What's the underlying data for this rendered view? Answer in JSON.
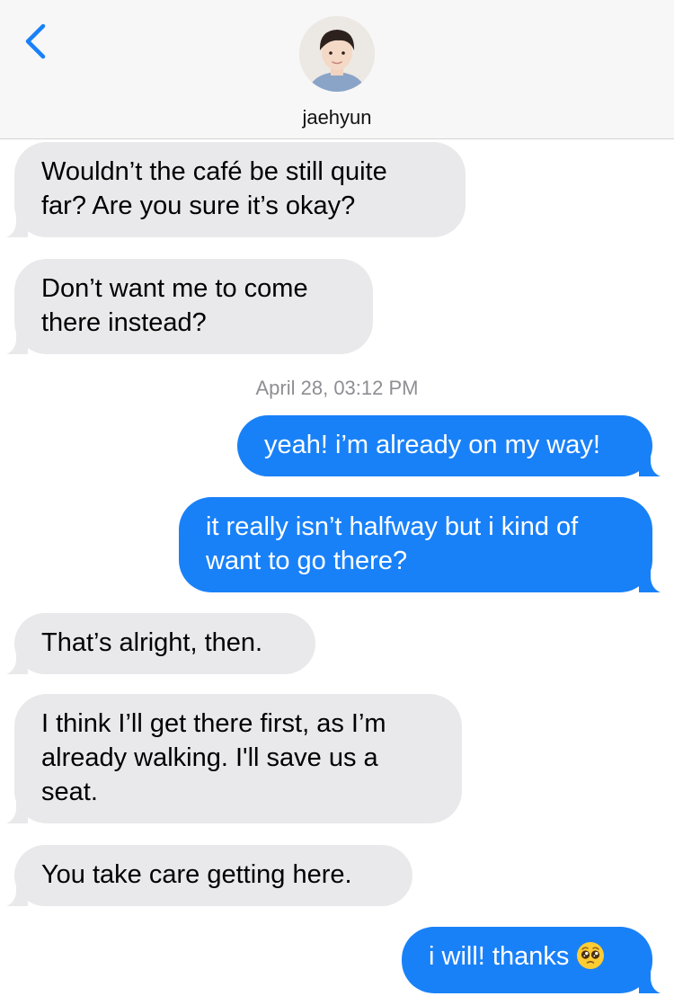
{
  "header": {
    "contact_name": "jaehyun",
    "back_icon": "chevron-left-icon",
    "accent_color": "#1981f8"
  },
  "messages": [
    {
      "direction": "incoming",
      "text": "Wouldn’t the café be still quite far? Are you sure it’s okay?"
    },
    {
      "direction": "incoming",
      "text": "Don’t want me to come there instead?"
    },
    {
      "direction": "outgoing",
      "text": "yeah! i’m already on my way!"
    },
    {
      "direction": "outgoing",
      "text": "it really isn’t halfway but i kind of want to go there?"
    },
    {
      "direction": "incoming",
      "text": "That’s alright, then."
    },
    {
      "direction": "incoming",
      "text": "I think I’ll get there first, as I’m already walking. I'll save us a seat."
    },
    {
      "direction": "incoming",
      "text": "You take care getting here."
    },
    {
      "direction": "outgoing",
      "text": "i will! thanks",
      "emoji": "pleading-face-icon"
    }
  ],
  "timestamp": "April 28, 03:12 PM",
  "colors": {
    "incoming_bubble": "#e9e9eb",
    "outgoing_bubble": "#1981f8",
    "header_bg": "#f7f7f7"
  }
}
